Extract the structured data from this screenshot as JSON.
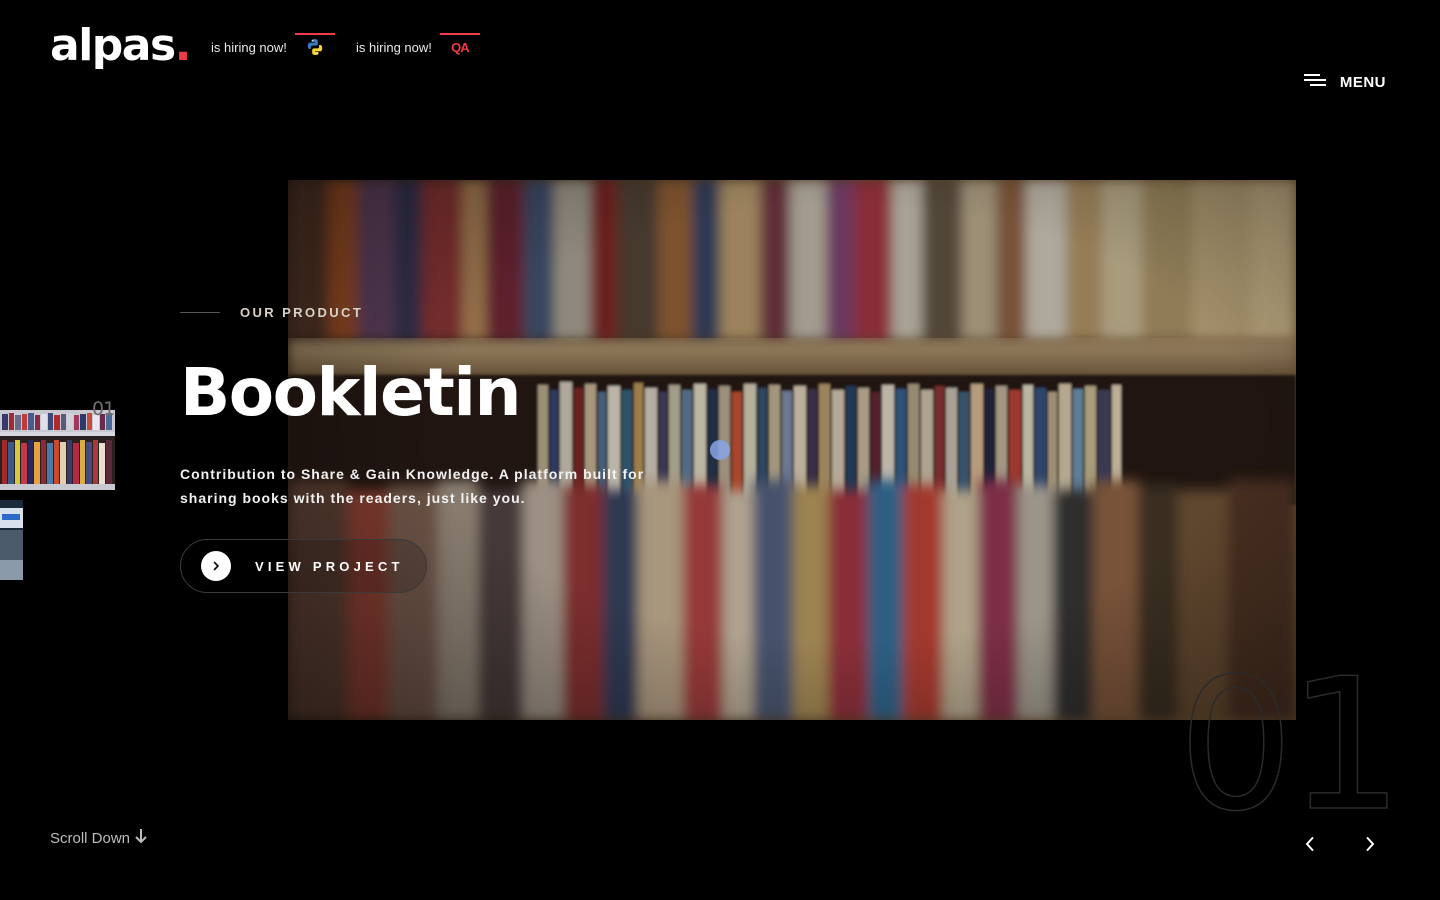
{
  "header": {
    "logo_text": "alpas",
    "logo_dot": ".",
    "hiring": [
      {
        "label": "is hiring now!",
        "icon": "python-icon"
      },
      {
        "label": "is hiring now!",
        "icon": "qa-icon",
        "icon_text": "QA"
      }
    ],
    "menu_label": "MENU"
  },
  "hero": {
    "eyebrow": "OUR PRODUCT",
    "title": "Bookletin",
    "description": "Contribution to Share & Gain Knowledge. A platform built for sharing books with the readers, just like you.",
    "cta_label": "VIEW PROJECT",
    "slide_number": "01"
  },
  "slider": {
    "thumb_number": "01"
  },
  "footer": {
    "scroll_label": "Scroll Down"
  },
  "colors": {
    "accent": "#ef3b46",
    "background": "#000000",
    "text": "#ffffff"
  }
}
